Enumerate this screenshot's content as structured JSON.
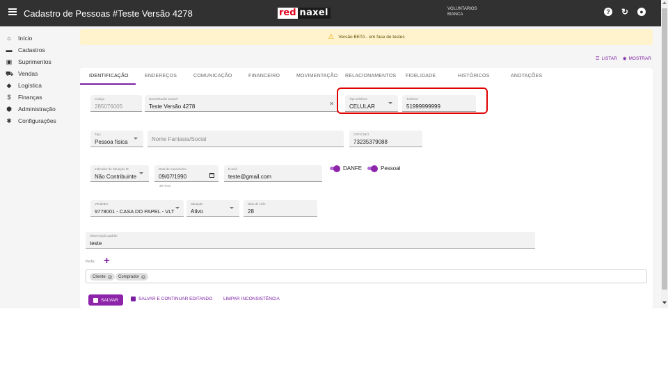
{
  "app": {
    "title": "Cadastro de Pessoas #Teste Versão 4278"
  },
  "brand": {
    "part1": "red",
    "part2": "naxel"
  },
  "user": {
    "line1": "VOLUNTARIOS",
    "line2": "BIANCA"
  },
  "sidebar": {
    "items": [
      {
        "label": "Início",
        "icon": "home-icon",
        "glyph": "⌂"
      },
      {
        "label": "Cadastros",
        "icon": "folder-icon",
        "glyph": "▬"
      },
      {
        "label": "Suprimentos",
        "icon": "box-icon",
        "glyph": "▣"
      },
      {
        "label": "Vendas",
        "icon": "cart-icon",
        "glyph": "⛟"
      },
      {
        "label": "Logística",
        "icon": "route-icon",
        "glyph": "◆"
      },
      {
        "label": "Finanças",
        "icon": "dollar-icon",
        "glyph": "$"
      },
      {
        "label": "Administração",
        "icon": "shield-icon",
        "glyph": "⬢"
      },
      {
        "label": "Configurações",
        "icon": "gear-icon",
        "glyph": "✱"
      }
    ]
  },
  "beta_notice": "Versão BETA - em fase de testes",
  "list_actions": {
    "listar": "LISTAR",
    "mostrar": "MOSTRAR"
  },
  "tabs": [
    "IDENTIFICAÇÃO",
    "ENDEREÇOS",
    "COMUNICAÇÃO",
    "FINANCEIRO",
    "MOVIMENTAÇÃO",
    "RELACIONAMENTOS",
    "FIDELIDADE",
    "HISTÓRICOS",
    "ANOTAÇÕES"
  ],
  "form": {
    "codigo": {
      "label": "Código",
      "value": "285076005"
    },
    "nome": {
      "label": "Nome/Razão Social *",
      "value": "Teste Versão 4278"
    },
    "tipo_telefone": {
      "label": "Tipo telefone",
      "value": "CELULAR"
    },
    "telefone": {
      "label": "Telefone",
      "value": "51999999999"
    },
    "tipo": {
      "label": "Tipo",
      "value": "Pessoa física"
    },
    "nome_fantasia": {
      "placeholder": "Nome Fantasia/Social"
    },
    "cpf": {
      "label": "CPF/CNPJ",
      "value": "73235379088"
    },
    "indicador": {
      "label": "Indicador de Situação IE",
      "value": "Não Contribuinte"
    },
    "nascimento": {
      "label": "Data de nascimento",
      "value": "09/07/1990",
      "hint": "30 Anos"
    },
    "email": {
      "label": "E-mail",
      "value": "teste@gmail.com"
    },
    "danfe": {
      "label": "DANFE"
    },
    "pessoal": {
      "label": "Pessoal"
    },
    "vendedor": {
      "label": "Vendedor",
      "value": "9778001 - CASA DO PAPEL - VLT"
    },
    "situacao": {
      "label": "Situação",
      "value": "Ativo"
    },
    "dias_ciclo": {
      "label": "Dias de ciclo",
      "value": "28"
    },
    "observacao": {
      "label": "Observação padrão",
      "value": "teste"
    },
    "perfis": {
      "label": "Perfis",
      "chips": [
        "Cliente",
        "Comprador"
      ]
    }
  },
  "actions": {
    "salvar": "SALVAR",
    "salvar_continuar": "SALVAR E CONTINUAR EDITANDO",
    "limpar": "LIMPAR INCONSISTÊNCIA"
  },
  "colors": {
    "accent": "#8e24aa",
    "topbar": "#313131",
    "highlight": "#e00000",
    "beta_bg": "#fff3cd"
  }
}
